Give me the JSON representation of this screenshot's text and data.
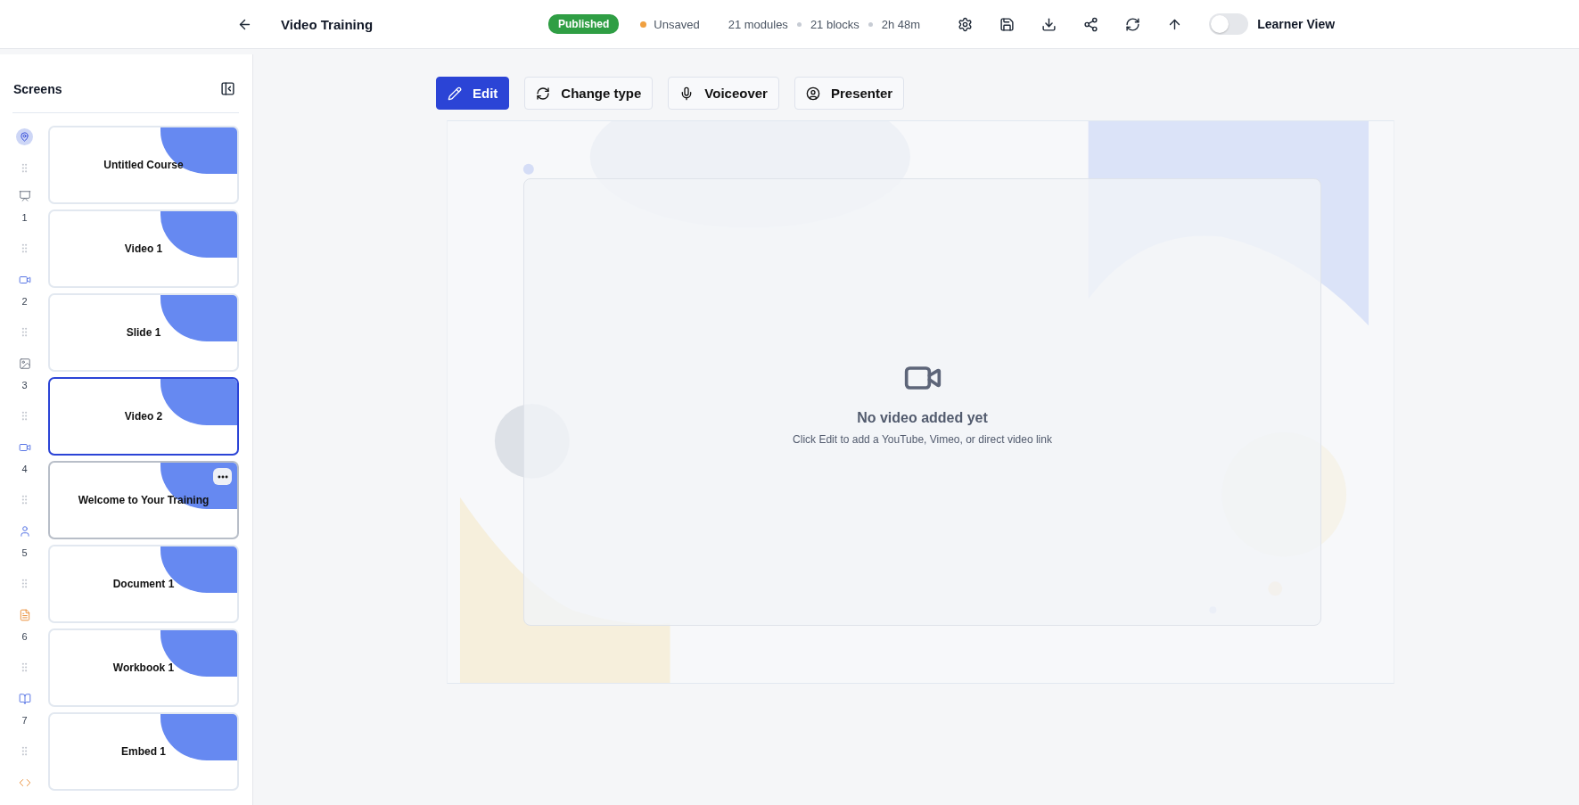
{
  "header": {
    "title": "Video Training",
    "status_badge": "Published",
    "save_state": "Unsaved",
    "stats": [
      "21 modules",
      "21 blocks",
      "2h 48m"
    ],
    "learner_view": {
      "label": "Learner View",
      "on": false
    }
  },
  "sidebar": {
    "title": "Screens",
    "screens": [
      {
        "kind": "slide",
        "title": "Untitled Course",
        "selected": false,
        "hovered": false
      },
      {
        "marker": "1",
        "kind": "video",
        "title": "Video 1",
        "selected": false,
        "hovered": false
      },
      {
        "marker": "2",
        "kind": "image",
        "title": "Slide 1",
        "selected": false,
        "hovered": false
      },
      {
        "marker": "3",
        "kind": "video",
        "title": "Video 2",
        "selected": true,
        "hovered": false
      },
      {
        "marker": "4",
        "kind": "presenter",
        "title": "Welcome to Your Training",
        "selected": false,
        "hovered": true
      },
      {
        "marker": "5",
        "kind": "document",
        "title": "Document 1",
        "selected": false,
        "hovered": false
      },
      {
        "marker": "6",
        "kind": "workbook",
        "title": "Workbook 1",
        "selected": false,
        "hovered": false
      },
      {
        "marker": "7",
        "kind": "embed",
        "title": "Embed 1",
        "selected": false,
        "hovered": false
      }
    ]
  },
  "toolbar": [
    {
      "label": "Edit",
      "kind": "edit",
      "primary": true
    },
    {
      "label": "Change type",
      "kind": "change",
      "primary": false
    },
    {
      "label": "Voiceover",
      "kind": "voice",
      "primary": false
    },
    {
      "label": "Presenter",
      "kind": "presenter",
      "primary": false
    }
  ],
  "empty_state": {
    "title": "No video added yet",
    "hint": "Click Edit to add a YouTube, Vimeo, or direct video link"
  }
}
